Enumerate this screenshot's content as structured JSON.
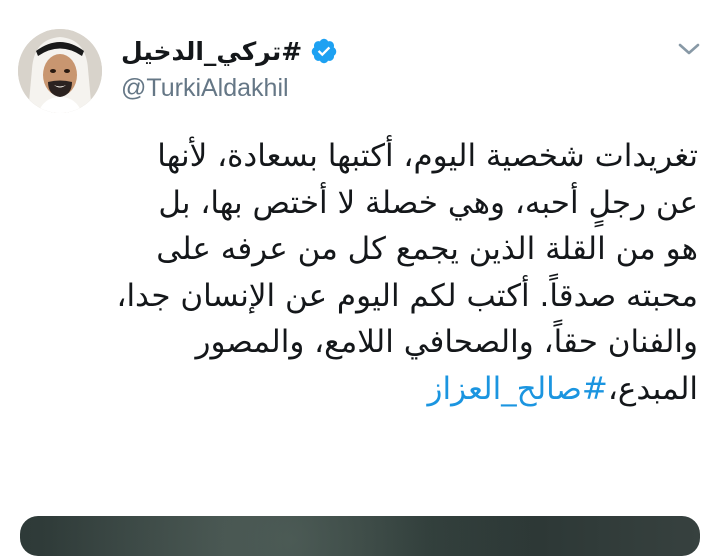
{
  "tweet": {
    "display_name": "#تركي_الدخيل",
    "handle": "@TurkiAldakhil",
    "lines": [
      "تغريدات شخصية اليوم، أكتبها بسعادة، لأنها",
      "عن رجلٍ أحبه، وهي خصلة لا أختص بها، بل",
      "هو من القلة الذين يجمع كل من عرفه على",
      "محبته صدقاً. أكتب لكم اليوم عن الإنسان جدا،",
      "والفنان حقاً، والصحافي اللامع، والمصور"
    ],
    "last_line_prefix": "المبدع،",
    "hashtag": "#صالح_العزاز"
  },
  "icons": {
    "verified": "verified-badge-icon",
    "caret": "chevron-down-icon"
  },
  "colors": {
    "link": "#1b95e0",
    "verified": "#1da1f2",
    "secondary_text": "#657786",
    "primary_text": "#14171a"
  }
}
